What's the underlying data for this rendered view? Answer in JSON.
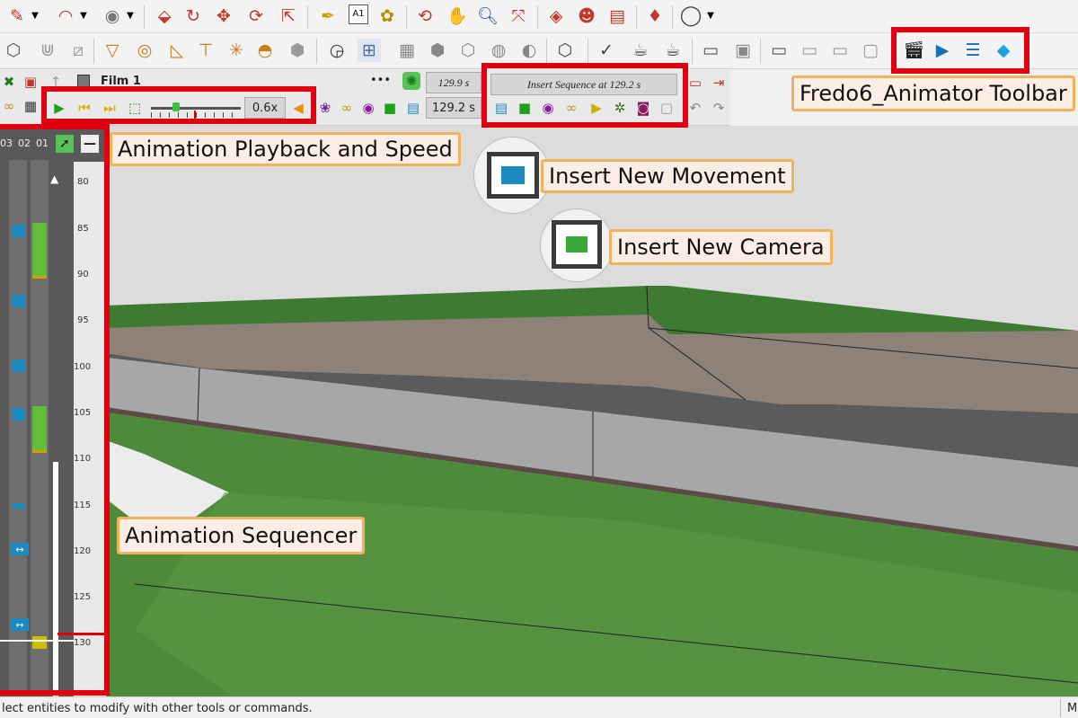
{
  "toolbar_row1": {
    "icons": [
      "pencil-icon",
      "arc-icon",
      "paint-bucket-icon",
      "push-pull-icon",
      "rotate-icon",
      "move-icon",
      "refresh-icon",
      "scale-icon",
      "tape-measure-icon",
      "text-label-icon",
      "paint-icon",
      "orbit-icon",
      "pan-hand-icon",
      "zoom-icon",
      "zoom-extents-icon",
      "section-red-icon",
      "component-faces-icon",
      "style-icon",
      "gem-icon",
      "user-account-icon"
    ],
    "text_label": "A1"
  },
  "toolbar_row2": {
    "icons": [
      "box-icon",
      "grass-icon",
      "eraser-icon",
      "lamp-icon",
      "target-icon",
      "table-icon",
      "sun-icon",
      "dome-icon",
      "sphere-icon",
      "circle-icon",
      "pattern-icon",
      "checker-icon",
      "cube-a-icon",
      "cube-b-icon",
      "ball-a-icon",
      "ball-b-icon",
      "cube-pointer-icon",
      "check-icon",
      "teapot-icon",
      "teapot-hand-icon",
      "tray-icon",
      "window-a-icon",
      "window-b-icon",
      "window-c-icon",
      "window-d-icon",
      "lock-icon"
    ],
    "animator_icons": [
      "clapper-icon",
      "screen-play-icon",
      "sliders-icon",
      "camera-lens-icon"
    ]
  },
  "animator_bar": {
    "film_name": "Film 1",
    "dots": "•••",
    "duration_top": "129.9 s",
    "duration_bottom": "129.2 s",
    "insert_sequence": "Insert Sequence at 129.2 s",
    "speed": "0.6x"
  },
  "sequencer": {
    "column_headers": [
      "03",
      "02",
      "01"
    ],
    "ruler_labels": [
      "80",
      "85",
      "90",
      "95",
      "100",
      "105",
      "110",
      "115",
      "120",
      "125",
      "130"
    ]
  },
  "callouts": {
    "playback": "Animation Playback and Speed",
    "movement": "Insert New Movement",
    "camera": "Insert New Camera",
    "toolbar": "Fredo6_Animator Toolbar",
    "sequencer": "Animation Sequencer"
  },
  "status_bar": {
    "message": "lect entities to modify with other tools or commands.",
    "right": "M"
  },
  "colors": {
    "highlight_red": "#e00010",
    "callout_border": "#f1b25c",
    "callout_fill": "#fdeee5",
    "grass": "#4d8a3a",
    "sky": "#dcdcdc",
    "sequencer_bg": "#595959"
  }
}
